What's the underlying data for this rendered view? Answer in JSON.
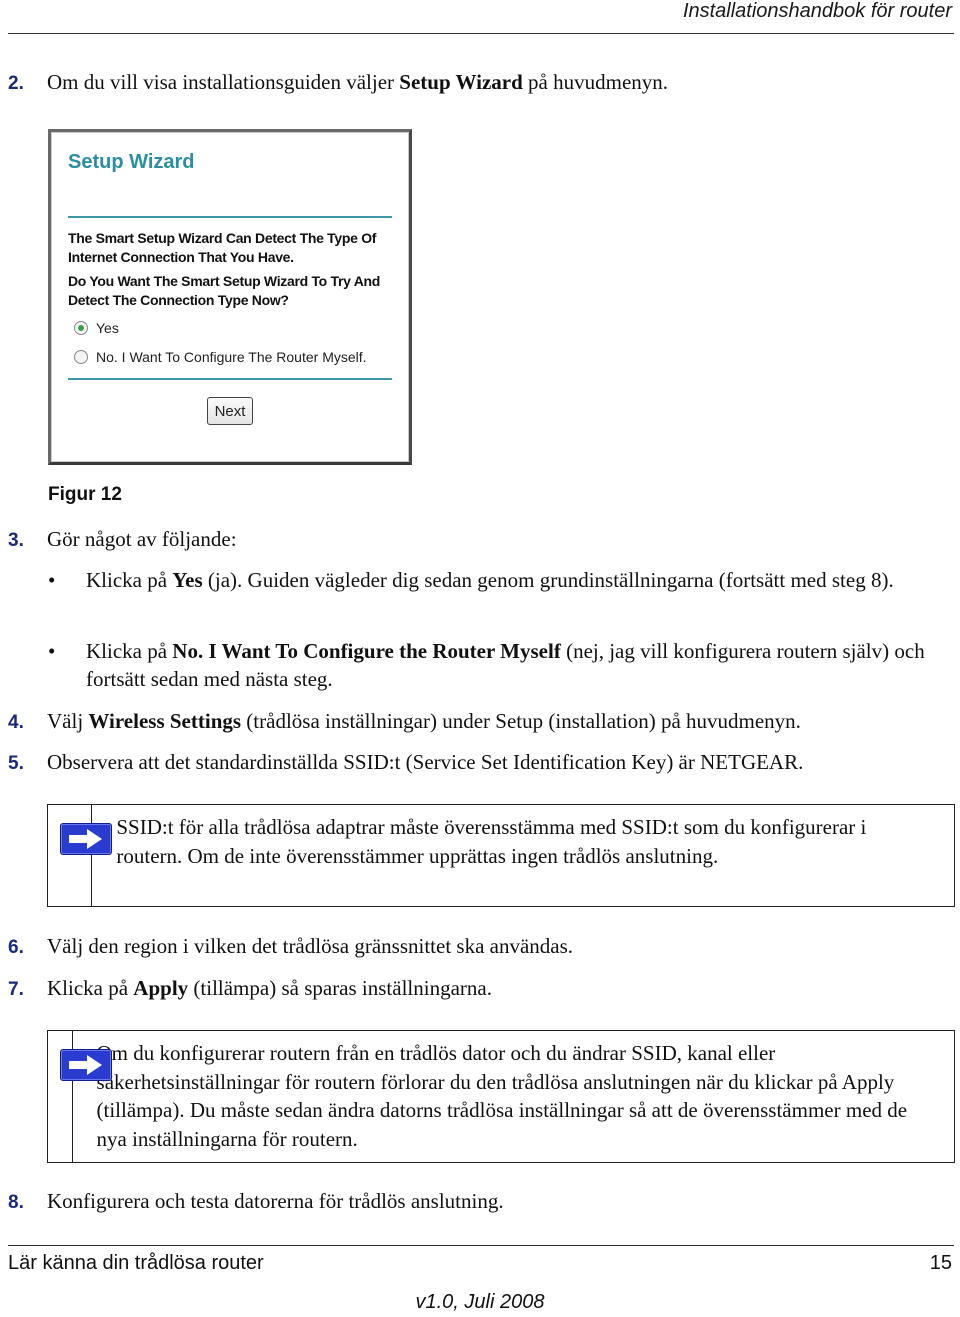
{
  "header": {
    "running_title": "Installationshandbok för router"
  },
  "steps": {
    "s2": {
      "num": "2.",
      "pre": "Om du vill visa installationsguiden väljer ",
      "bold": "Setup Wizard",
      "post": " på huvudmenyn."
    },
    "s3": {
      "num": "3.",
      "text": "Gör något av följande:"
    },
    "s4": {
      "num": "4.",
      "pre": "Välj ",
      "bold": "Wireless Settings",
      "post": " (trådlösa inställningar) under Setup (installation) på huvudmenyn."
    },
    "s5": {
      "num": "5.",
      "text": "Observera att det standardinställda SSID:t (Service Set Identification Key) är NETGEAR."
    },
    "s6": {
      "num": "6.",
      "text": "Välj den region i vilken det trådlösa gränssnittet ska användas."
    },
    "s7": {
      "num": "7.",
      "pre": "Klicka på ",
      "bold": "Apply",
      "post": " (tillämpa) så sparas inställningarna."
    },
    "s8": {
      "num": "8.",
      "text": "Konfigurera och testa datorerna för trådlös anslutning."
    }
  },
  "bullets": [
    {
      "marker": "•",
      "pre": "Klicka på ",
      "bold": "Yes",
      "post": " (ja). Guiden vägleder dig sedan genom grundinställningarna (fortsätt med steg 8)."
    },
    {
      "marker": "•",
      "pre": "Klicka på ",
      "bold": "No. I Want To Configure the Router Myself",
      "post": " (nej, jag vill konfigurera routern själv) och fortsätt sedan med nästa steg."
    }
  ],
  "figure": {
    "caption": "Figur 12",
    "wizard": {
      "title": "Setup Wizard",
      "text1": "The Smart Setup Wizard Can Detect The Type Of Internet Connection That You Have.",
      "text2": "Do You Want The Smart Setup Wizard To Try And Detect The Connection Type Now?",
      "options": [
        {
          "label": "Yes",
          "checked": true
        },
        {
          "label": "No. I Want To Configure The Router Myself.",
          "checked": false
        }
      ],
      "next_label": "Next",
      "accent_color": "#2a8fa0"
    }
  },
  "notes": [
    {
      "icon": "arrow-right-icon",
      "text": "SSID:t för alla trådlösa adaptrar måste överensstämma med SSID:t som du konfigurerar i routern. Om de inte överensstämmer upprättas ingen trådlös anslutning."
    },
    {
      "icon": "arrow-right-icon",
      "text": "Om du konfigurerar routern från en trådlös dator och du ändrar SSID, kanal eller säkerhetsinställningar för routern förlorar du den trådlösa anslutningen när du klickar på Apply (tillämpa). Du måste sedan ändra datorns trådlösa inställningar så att de överensstämmer med de nya inställningarna för routern."
    }
  ],
  "footer": {
    "chapter": "Lär känna din trådlösa router",
    "page": "15",
    "version": "v1.0, Juli 2008"
  }
}
